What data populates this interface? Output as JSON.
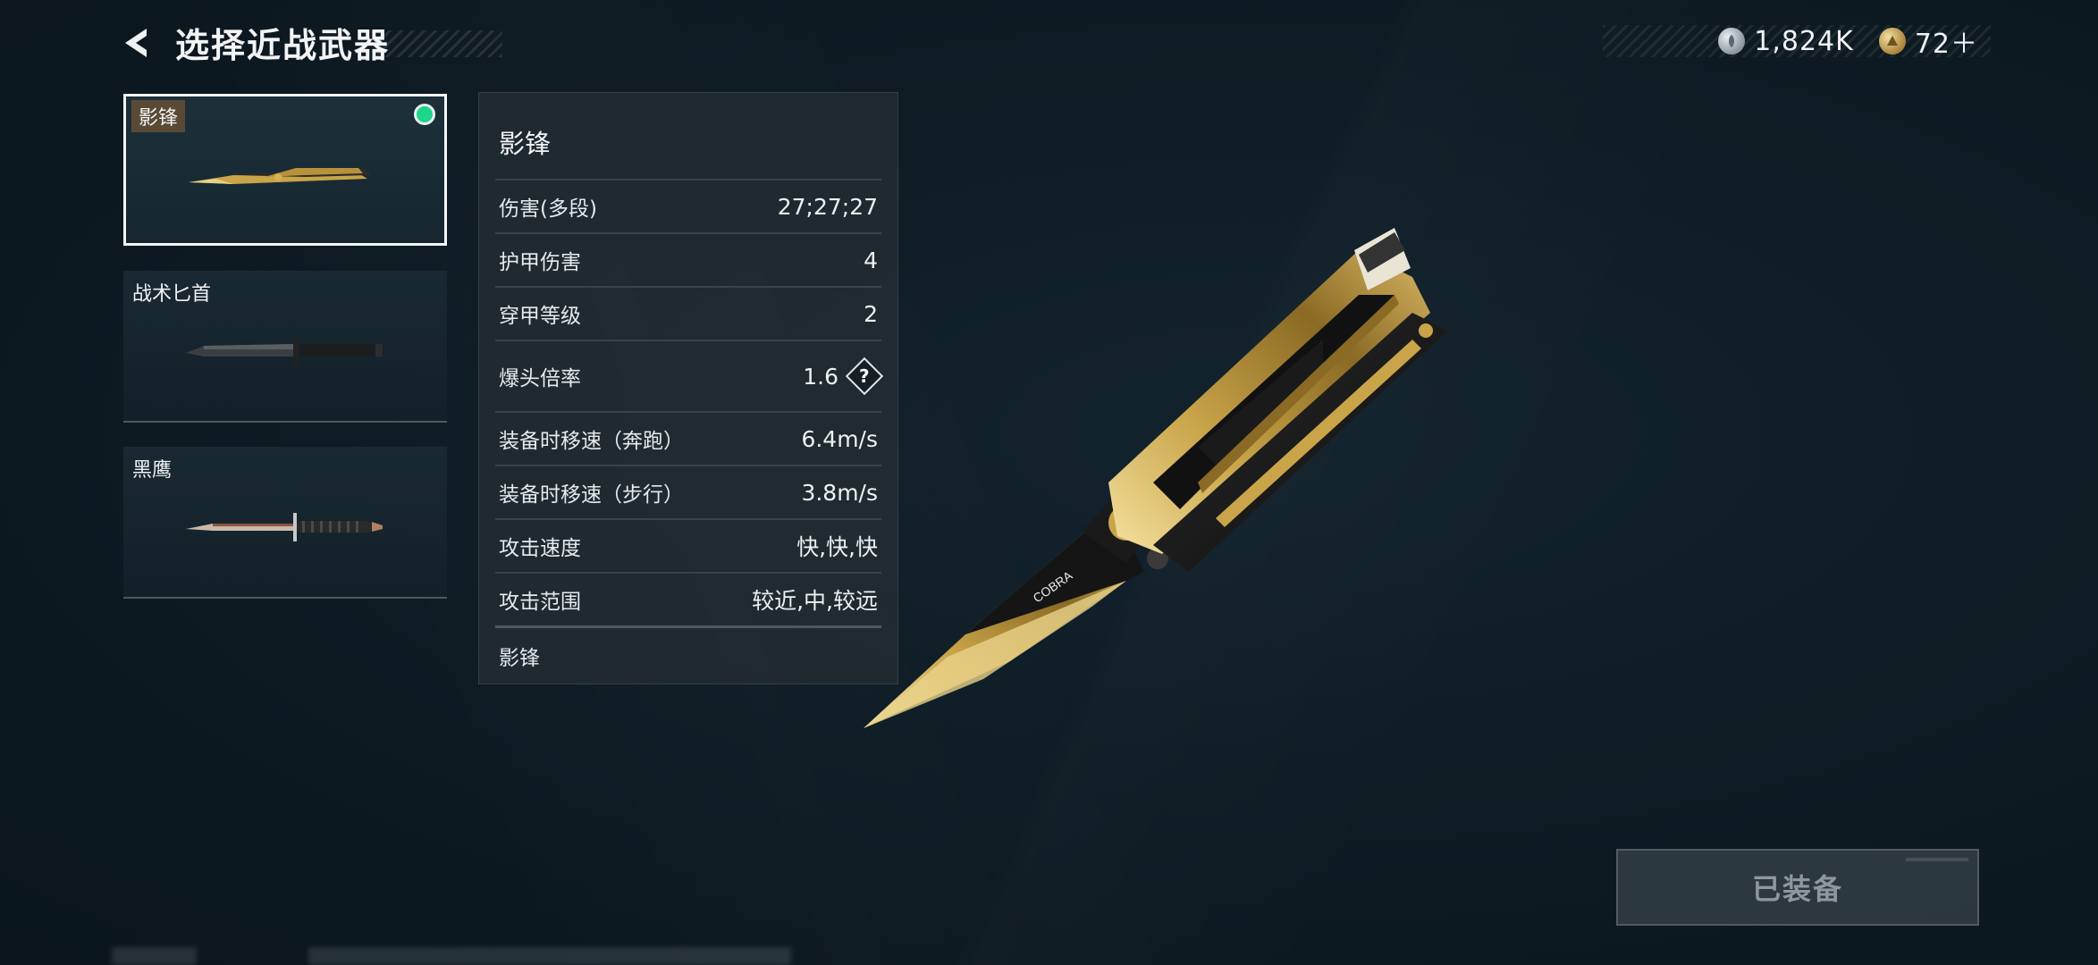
{
  "header": {
    "back_icon": "chevron-left-icon",
    "title": "选择近战武器"
  },
  "currency": [
    {
      "icon": "silver-coin-icon",
      "value": "1,824K"
    },
    {
      "icon": "gold-coin-icon",
      "value": "72＋"
    }
  ],
  "weapons": [
    {
      "name": "影锋",
      "selected": true,
      "equipped": true
    },
    {
      "name": "战术匕首",
      "selected": false,
      "equipped": false
    },
    {
      "name": "黑鹰",
      "selected": false,
      "equipped": false
    }
  ],
  "stats": {
    "title": "影锋",
    "rows": [
      {
        "label": "伤害(多段)",
        "value": "27;27;27"
      },
      {
        "label": "护甲伤害",
        "value": "4"
      },
      {
        "label": "穿甲等级",
        "value": "2"
      },
      {
        "label": "爆头倍率",
        "value": "1.6",
        "help": "?"
      },
      {
        "label": "装备时移速（奔跑）",
        "value": "6.4m/s"
      },
      {
        "label": "装备时移速（步行）",
        "value": "3.8m/s"
      },
      {
        "label": "攻击速度",
        "value": "快,快,快"
      },
      {
        "label": "攻击范围",
        "value": "较近,中,较远"
      }
    ],
    "footer": "影锋"
  },
  "knife_engraving": "COBRA",
  "equip_button": {
    "label": "已装备",
    "state": "disabled"
  },
  "colors": {
    "background": "#0e1c25",
    "panel": "#212a31",
    "equipped_dot": "#1ed58a",
    "gold": "#c9a449"
  }
}
